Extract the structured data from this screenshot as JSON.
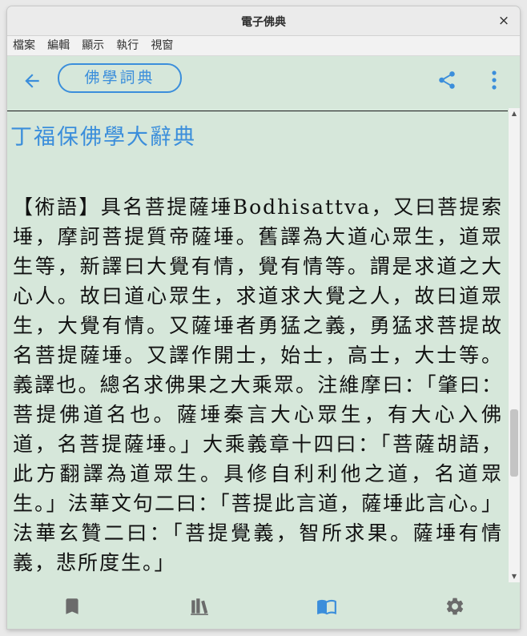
{
  "window": {
    "title": "電子佛典",
    "close_glyph": "×"
  },
  "menubar": {
    "items": [
      "檔案",
      "編輯",
      "顯示",
      "執行",
      "視窗"
    ]
  },
  "toolbar": {
    "search_label": "佛學詞典",
    "icons": [
      "arrow-left-icon",
      "share-icon",
      "more-vertical-icon"
    ],
    "accent_color": "#3b8edb"
  },
  "content": {
    "dict_title": "丁福保佛學大辭典",
    "body": "【術語】具名菩提薩埵Bodhisattva，又曰菩提索埵，摩訶菩提質帝薩埵。舊譯為大道心眾生，道眾生等，新譯曰大覺有情，覺有情等。謂是求道之大心人。故曰道心眾生，求道求大覺之人，故曰道眾生，大覺有情。又薩埵者勇猛之義，勇猛求菩提故名菩提薩埵。又譯作開士，始士，高士，大士等。義譯也。總名求佛果之大乘眾。注維摩曰：「肇曰：菩提佛道名也。薩埵秦言大心眾生，有大心入佛道，名菩提薩埵。」大乘義章十四曰：「菩薩胡語，此方翻譯為道眾生。具修自利利他之道，名道眾生。」法華文句二曰：「菩提此言道，薩埵此言心。」法華玄贊二曰：「菩提覺義，智所求果。薩埵有情義，悲所度生。」"
  },
  "bottom_nav": {
    "items": [
      "bookmark-icon",
      "library-icon",
      "book-open-icon",
      "gear-icon"
    ],
    "active_index": 2,
    "inactive_color": "#6b6b6b",
    "active_color": "#3b8edb"
  },
  "colors": {
    "background": "#d6e7da",
    "accent": "#3b8edb"
  }
}
